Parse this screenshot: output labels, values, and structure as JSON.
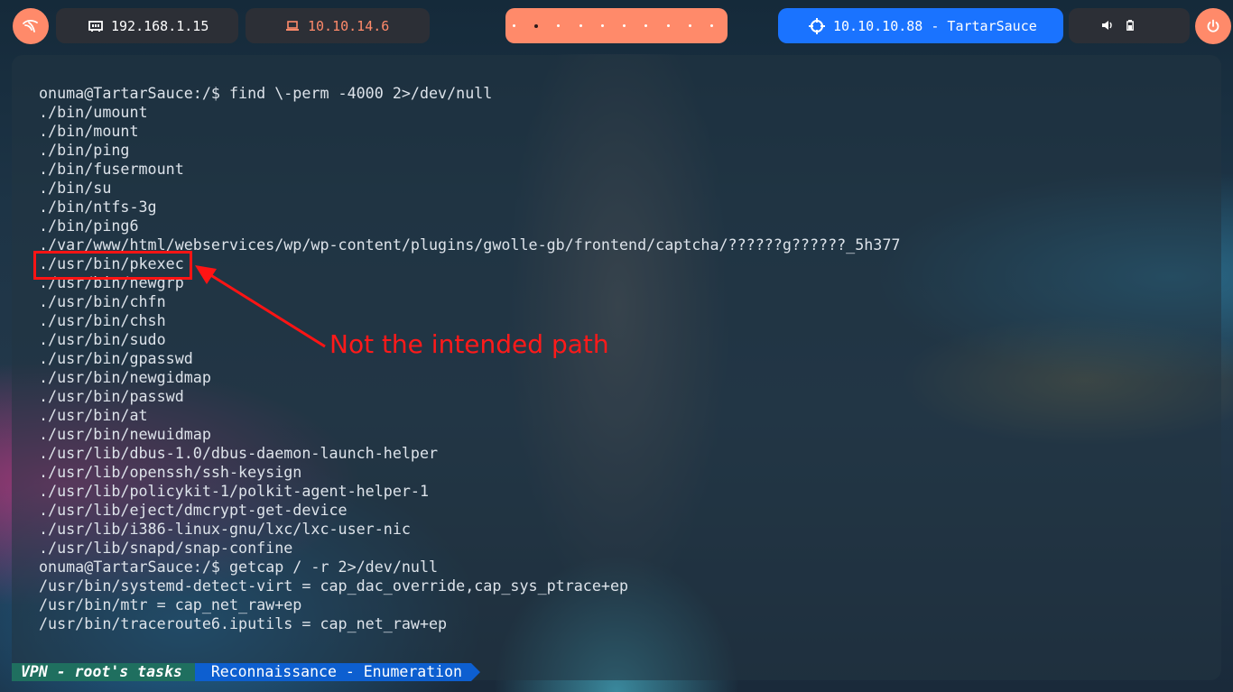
{
  "topbar": {
    "host_ip": "192.168.1.15",
    "vpn_ip": "10.10.14.6",
    "target": "10.10.10.88 - TartarSauce",
    "workspaces": [
      true,
      false,
      false,
      false,
      false,
      false,
      false,
      false,
      false,
      false
    ]
  },
  "terminal": {
    "lines": [
      "onuma@TartarSauce:/$ find \\-perm -4000 2>/dev/null",
      "./bin/umount",
      "./bin/mount",
      "./bin/ping",
      "./bin/fusermount",
      "./bin/su",
      "./bin/ntfs-3g",
      "./bin/ping6",
      "./var/www/html/webservices/wp/wp-content/plugins/gwolle-gb/frontend/captcha/??????g??????_5h377",
      "./usr/bin/pkexec",
      "./usr/bin/newgrp",
      "./usr/bin/chfn",
      "./usr/bin/chsh",
      "./usr/bin/sudo",
      "./usr/bin/gpasswd",
      "./usr/bin/newgidmap",
      "./usr/bin/passwd",
      "./usr/bin/at",
      "./usr/bin/newuidmap",
      "./usr/lib/dbus-1.0/dbus-daemon-launch-helper",
      "./usr/lib/openssh/ssh-keysign",
      "./usr/lib/policykit-1/polkit-agent-helper-1",
      "./usr/lib/eject/dmcrypt-get-device",
      "./usr/lib/i386-linux-gnu/lxc/lxc-user-nic",
      "./usr/lib/snapd/snap-confine",
      "onuma@TartarSauce:/$ getcap / -r 2>/dev/null",
      "/usr/bin/systemd-detect-virt = cap_dac_override,cap_sys_ptrace+ep",
      "/usr/bin/mtr = cap_net_raw+ep",
      "/usr/bin/traceroute6.iputils = cap_net_raw+ep"
    ]
  },
  "annotation": {
    "text": "Not the intended path",
    "color": "#ff1a1a"
  },
  "statusbar": {
    "session": "VPN - root's tasks",
    "window": "Reconnaissance - Enumeration"
  },
  "colors": {
    "accent": "#ff8a6a",
    "target_bg": "#1a73ff",
    "pill_bg": "#2c2f36",
    "status_green": "#1f6f5f",
    "status_blue": "#0d5fd0"
  }
}
